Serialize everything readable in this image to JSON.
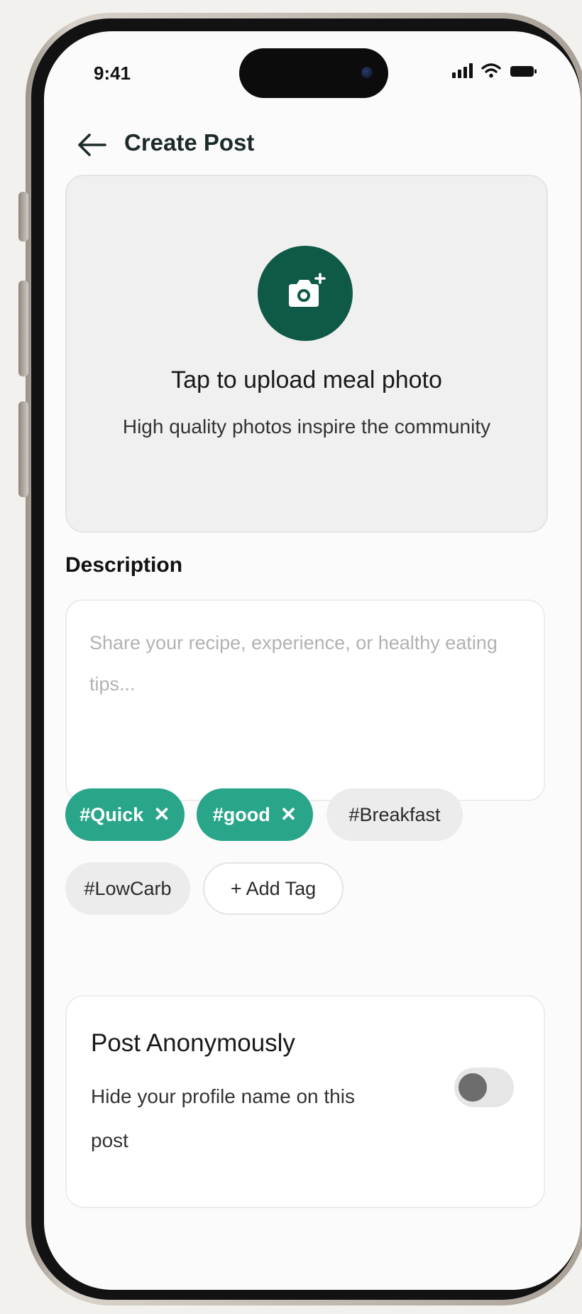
{
  "status_bar": {
    "time": "9:41"
  },
  "header": {
    "title": "Create Post"
  },
  "upload": {
    "title": "Tap to upload meal photo",
    "subtitle": "High quality photos inspire the community"
  },
  "description": {
    "label": "Description",
    "placeholder": "Share your recipe, experience, or healthy eating tips...",
    "value": ""
  },
  "tags": {
    "items": [
      {
        "label": "#Quick",
        "selected": true
      },
      {
        "label": "#good",
        "selected": true
      },
      {
        "label": "#Breakfast",
        "selected": false
      },
      {
        "label": "#LowCarb",
        "selected": false
      }
    ],
    "add_label": "+ Add Tag",
    "remove_glyph": "✕"
  },
  "anonymous": {
    "title": "Post Anonymously",
    "description": "Hide your profile name on this post",
    "enabled": false
  },
  "colors": {
    "accent": "#29a58a",
    "camera_circle": "#0f5a47",
    "toggle_off": "#e6e6e6"
  },
  "icons": {
    "back": "back-arrow-icon",
    "camera": "camera-plus-icon",
    "signal": "signal-icon",
    "wifi": "wifi-icon",
    "battery": "battery-icon"
  }
}
